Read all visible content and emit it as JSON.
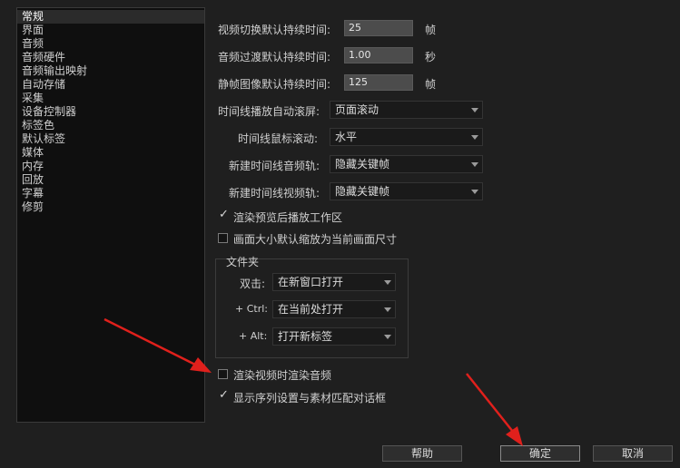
{
  "sidebar": {
    "items": [
      "常规",
      "界面",
      "音频",
      "音频硬件",
      "音频输出映射",
      "自动存储",
      "采集",
      "设备控制器",
      "标签色",
      "默认标签",
      "媒体",
      "内存",
      "回放",
      "字幕",
      "修剪"
    ]
  },
  "durations": {
    "video_label": "视频切换默认持续时间:",
    "video_value": "25",
    "video_unit": "帧",
    "audio_label": "音频过渡默认持续时间:",
    "audio_value": "1.00",
    "audio_unit": "秒",
    "still_label": "静帧图像默认持续时间:",
    "still_value": "125",
    "still_unit": "帧"
  },
  "timeline": {
    "autoscroll_label": "时间线播放自动滚屏:",
    "autoscroll_value": "页面滚动",
    "mousescroll_label": "时间线鼠标滚动:",
    "mousescroll_value": "水平",
    "audio_track_label": "新建时间线音频轨:",
    "audio_track_value": "隐藏关键帧",
    "video_track_label": "新建时间线视频轨:",
    "video_track_value": "隐藏关键帧"
  },
  "options": {
    "render_preview": "渲染预览后播放工作区",
    "scale_frame": "画面大小默认缩放为当前画面尺寸",
    "render_audio": "渲染视频时渲染音频",
    "show_sequence": "显示序列设置与素材匹配对话框"
  },
  "folder": {
    "title": "文件夹",
    "dblclick_label": "双击:",
    "dblclick_value": "在新窗口打开",
    "ctrl_label": "+ Ctrl:",
    "ctrl_value": "在当前处打开",
    "alt_label": "+ Alt:",
    "alt_value": "打开新标签"
  },
  "buttons": {
    "help": "帮助",
    "ok": "确定",
    "cancel": "取消"
  },
  "colors": {
    "annotation_arrow": "#e0201c"
  }
}
